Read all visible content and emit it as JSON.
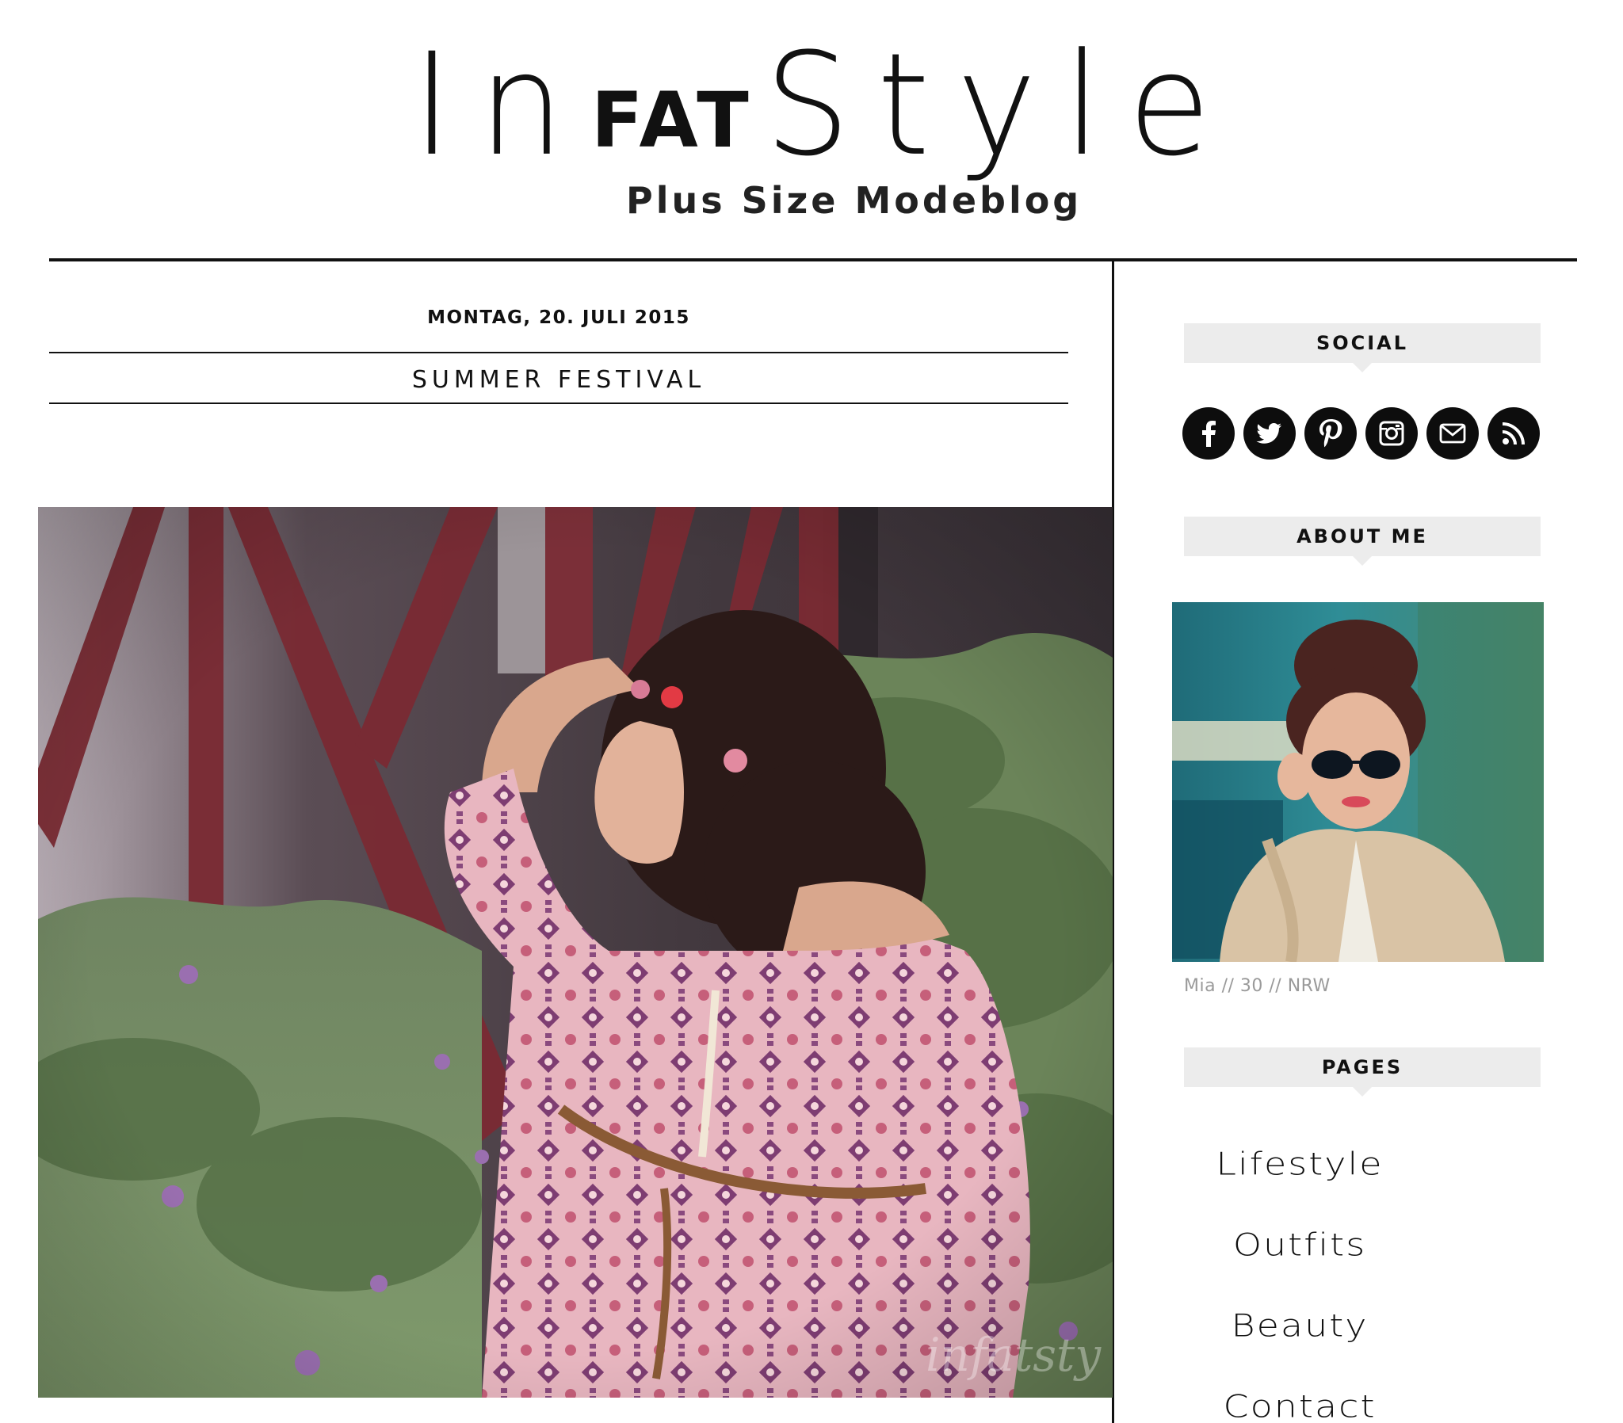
{
  "header": {
    "logo_in": "In",
    "logo_fat": "FAT",
    "logo_style": "Style",
    "tagline": "Plus Size Modeblog"
  },
  "post": {
    "date": "MONTAG, 20. JULI 2015",
    "title": "SUMMER FESTIVAL",
    "watermark": "infatsty"
  },
  "sidebar": {
    "social": {
      "heading": "SOCIAL",
      "icons": [
        "facebook-icon",
        "twitter-icon",
        "pinterest-icon",
        "instagram-icon",
        "mail-icon",
        "rss-icon"
      ]
    },
    "about": {
      "heading": "ABOUT ME",
      "caption": "Mia // 30 // NRW"
    },
    "pages": {
      "heading": "PAGES",
      "items": [
        {
          "label": "Lifestyle"
        },
        {
          "label": "Outfits"
        },
        {
          "label": "Beauty"
        },
        {
          "label": "Contact"
        }
      ]
    }
  },
  "colors": {
    "text": "#111111",
    "widget_bg": "#ececec",
    "caption": "#9a9a9a",
    "steel": "#7a2a33",
    "foliage": "#5b7a4a",
    "dress": "#d9a0ac"
  }
}
